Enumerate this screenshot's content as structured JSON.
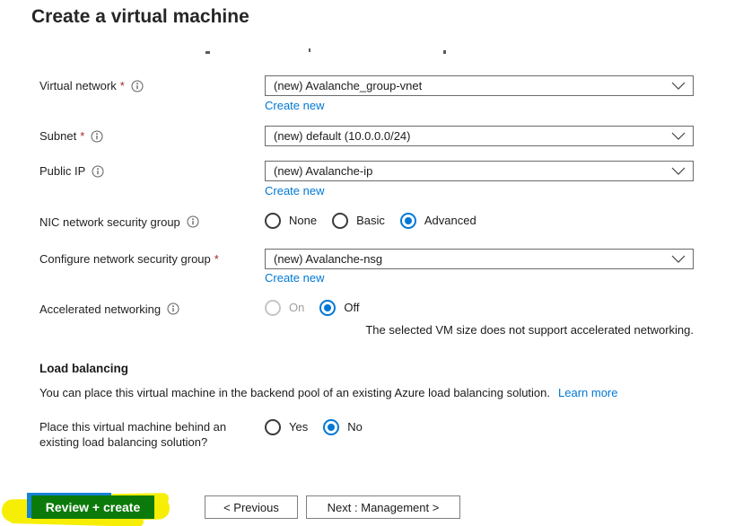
{
  "title": "Create a virtual machine",
  "ui": {
    "required_marker": "*",
    "create_new_label": "Create new"
  },
  "form": {
    "virtual_network": {
      "label": "Virtual network",
      "value": "(new) Avalanche_group-vnet"
    },
    "subnet": {
      "label": "Subnet",
      "value": "(new) default (10.0.0.0/24)"
    },
    "public_ip": {
      "label": "Public IP",
      "value": "(new) Avalanche-ip"
    },
    "nic_nsg": {
      "label": "NIC network security group",
      "options": [
        "None",
        "Basic",
        "Advanced"
      ],
      "selected": "Advanced"
    },
    "configure_nsg": {
      "label": "Configure network security group",
      "value": "(new) Avalanche-nsg"
    },
    "accelerated_networking": {
      "label": "Accelerated networking",
      "options": [
        "On",
        "Off"
      ],
      "selected": "Off",
      "disabled_option": "On",
      "note": "The selected VM size does not support accelerated networking."
    }
  },
  "load_balancing": {
    "heading": "Load balancing",
    "description": "You can place this virtual machine in the backend pool of an existing Azure load balancing solution.",
    "learn_more_label": "Learn more",
    "question": "Place this virtual machine behind an existing load balancing solution?",
    "options": [
      "Yes",
      "No"
    ],
    "selected": "No"
  },
  "footer": {
    "review_create_label": "Review + create",
    "previous_label": "< Previous",
    "next_label": "Next : Management >"
  },
  "colors": {
    "accent_blue": "#0078d4",
    "button_green": "#0b7a0b",
    "highlighter_yellow": "#f7ee05",
    "required_red": "#a4262c"
  }
}
